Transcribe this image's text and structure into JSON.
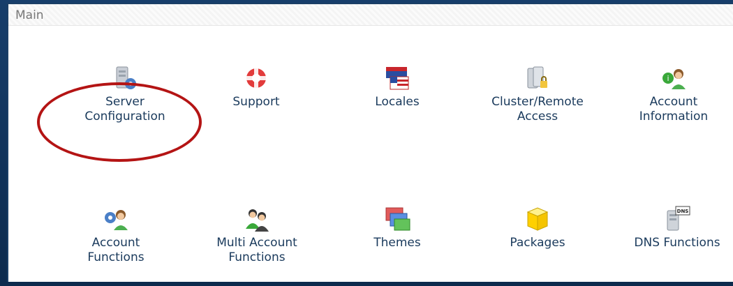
{
  "panel": {
    "title": "Main"
  },
  "items": [
    {
      "label_lines": [
        "Server",
        "Configuration"
      ],
      "icon": "server-gear-icon"
    },
    {
      "label_lines": [
        "Support",
        ""
      ],
      "icon": "lifebuoy-icon"
    },
    {
      "label_lines": [
        "Locales",
        ""
      ],
      "icon": "flags-icon"
    },
    {
      "label_lines": [
        "Cluster/Remote",
        "Access"
      ],
      "icon": "server-lock-icon"
    },
    {
      "label_lines": [
        "Account",
        "Information"
      ],
      "icon": "user-info-icon"
    },
    {
      "label_lines": [
        "Account",
        "Functions"
      ],
      "icon": "user-gear-icon"
    },
    {
      "label_lines": [
        "Multi Account",
        "Functions"
      ],
      "icon": "multi-user-icon"
    },
    {
      "label_lines": [
        "Themes",
        ""
      ],
      "icon": "windows-icon"
    },
    {
      "label_lines": [
        "Packages",
        ""
      ],
      "icon": "package-box-icon"
    },
    {
      "label_lines": [
        "DNS Functions",
        ""
      ],
      "icon": "dns-server-icon"
    }
  ],
  "colors": {
    "highlight_ring": "#b41414",
    "label_text": "#1a3a5c",
    "frame": "#0d2d52"
  }
}
